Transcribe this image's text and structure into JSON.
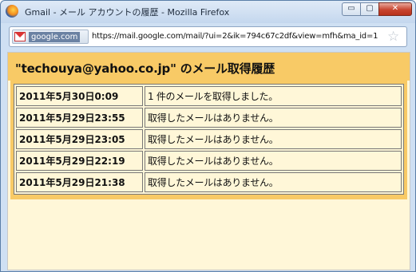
{
  "window": {
    "title": "Gmail - メール アカウントの履歴 - Mozilla Firefox",
    "controls": {
      "minimize": "▭",
      "maximize": "▢",
      "close": "✕"
    }
  },
  "address_bar": {
    "site_label": "google.com",
    "url": "https://mail.google.com/mail/?ui=2&ik=794c67c2df&view=mfh&ma_id=1"
  },
  "page": {
    "title": "\"techouya@yahoo.co.jp\" のメール取得履歴",
    "rows": [
      {
        "date": "2011年5月30日0:09",
        "message": "1 件のメールを取得しました。"
      },
      {
        "date": "2011年5月29日23:55",
        "message": "取得したメールはありません。"
      },
      {
        "date": "2011年5月29日23:05",
        "message": "取得したメールはありません。"
      },
      {
        "date": "2011年5月29日22:19",
        "message": "取得したメールはありません。"
      },
      {
        "date": "2011年5月29日21:38",
        "message": "取得したメールはありません。"
      }
    ]
  },
  "colors": {
    "header_band": "#f8ca66",
    "content_bg": "#fff7d8",
    "window_chrome": "#cfe0f3"
  },
  "icons": {
    "app": "firefox-icon",
    "site": "gmail-icon",
    "bookmark": "star-icon"
  }
}
